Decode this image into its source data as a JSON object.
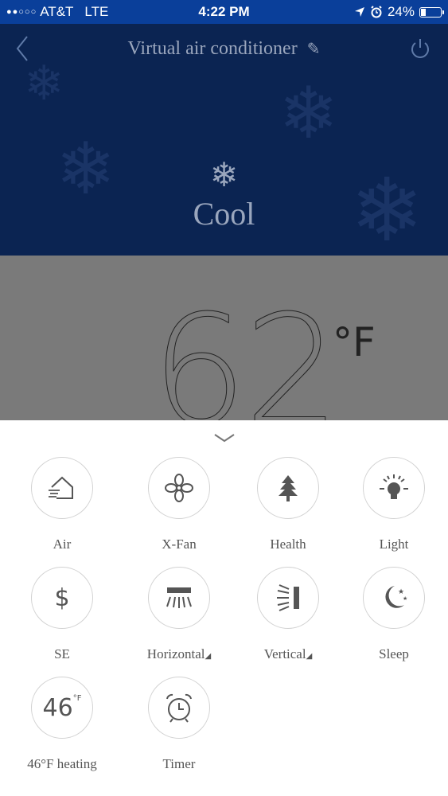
{
  "status_bar": {
    "carrier": "AT&T",
    "network": "LTE",
    "time": "4:22 PM",
    "battery": "24%",
    "battery_level": 0.24,
    "signal_dots": "●●○○○"
  },
  "header": {
    "title": "Virtual air conditioner",
    "mode_label": "Cool"
  },
  "temperature": {
    "value": "62",
    "unit": "°F"
  },
  "controls": [
    {
      "label": "Air",
      "icon": "air-house-icon"
    },
    {
      "label": "X-Fan",
      "icon": "fan-icon"
    },
    {
      "label": "Health",
      "icon": "tree-icon"
    },
    {
      "label": "Light",
      "icon": "light-bulb-icon"
    },
    {
      "label": "SE",
      "icon": "dollar-icon"
    },
    {
      "label": "Horizontal",
      "icon": "horizontal-swing-icon"
    },
    {
      "label": "Vertical",
      "icon": "vertical-swing-icon"
    },
    {
      "label": "Sleep",
      "icon": "moon-stars-icon"
    },
    {
      "label": "46°F heating",
      "icon": "46f-icon",
      "icon_text": "46",
      "icon_unit": "°F"
    },
    {
      "label": "Timer",
      "icon": "alarm-clock-icon"
    }
  ],
  "colors": {
    "status_bar": "#0a3f9a",
    "header_bg": "#0b2452",
    "temp_bg": "#7a7a7a",
    "panel_bg": "#ffffff"
  }
}
